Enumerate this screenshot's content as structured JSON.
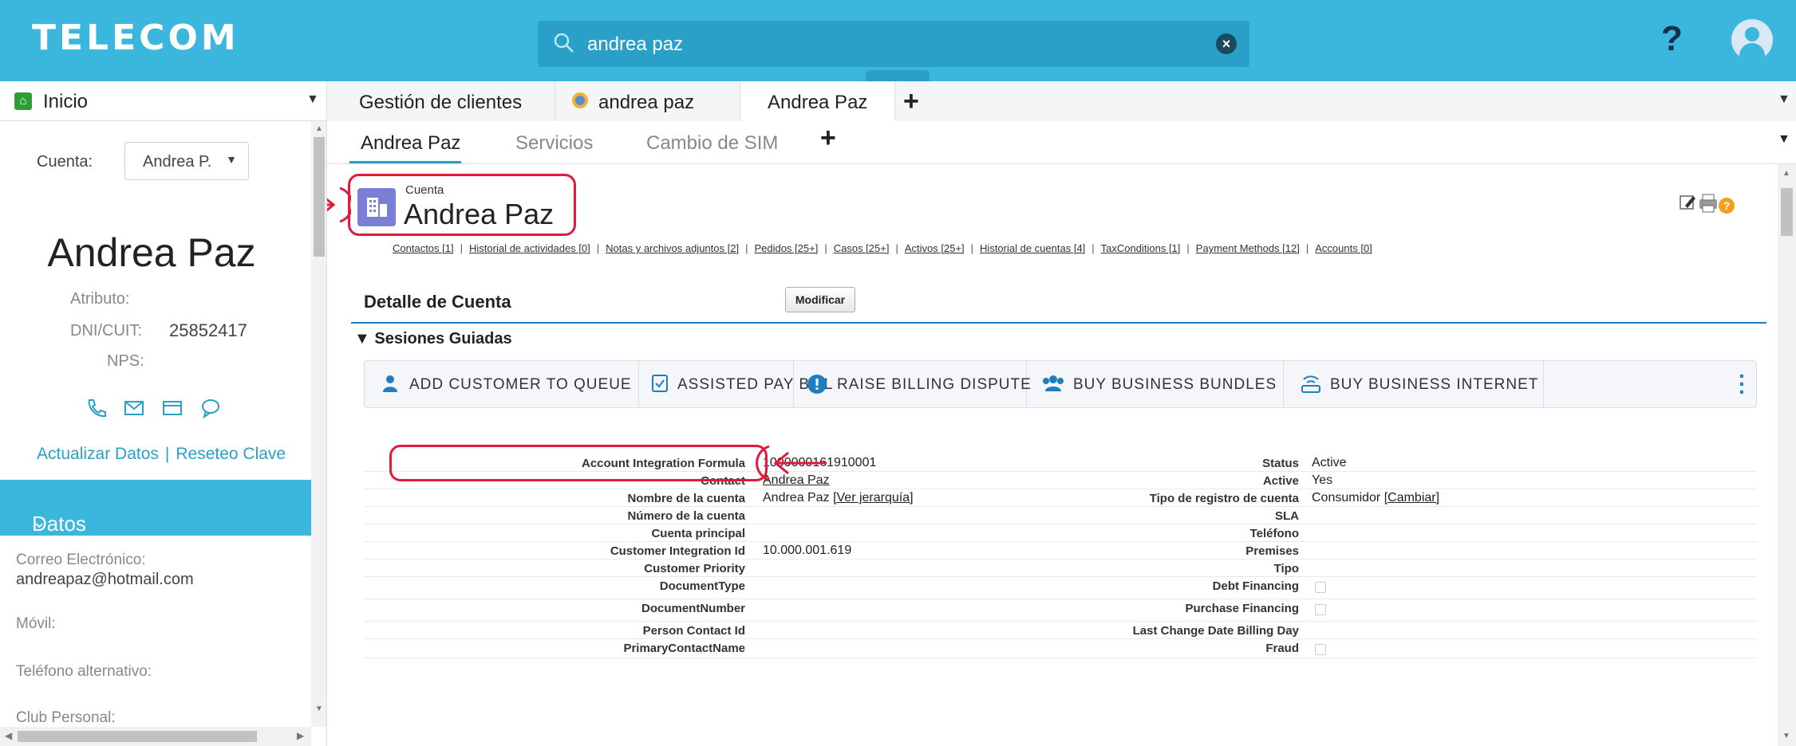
{
  "app": {
    "brand": "TELECOM"
  },
  "search": {
    "value": "andrea paz",
    "clear_label": "×"
  },
  "header": {
    "help_label": "?"
  },
  "workspace_tabs": {
    "home_label": "Inicio",
    "tabs": [
      {
        "label": "Gestión de clientes"
      },
      {
        "label": "andrea paz"
      },
      {
        "label": "Andrea Paz"
      }
    ],
    "add_label": "+"
  },
  "left_panel": {
    "account_label": "Cuenta:",
    "account_select": "Andrea P.",
    "customer_name": "Andrea Paz",
    "atributo_label": "Atributo:",
    "dni_label": "DNI/CUIT:",
    "dni_value": "25852417",
    "nps_label": "NPS:",
    "link_update": "Actualizar Datos",
    "link_sep": "|",
    "link_reset": "Reseteo Clave",
    "section_title": "Datos Personales",
    "email_label": "Correo Electrónico:",
    "email_value": "andreapaz@hotmail.com",
    "mobile_label": "Móvil:",
    "alt_phone_label": "Teléfono alternativo:",
    "club_label": "Club Personal:"
  },
  "subtabs": {
    "items": [
      {
        "label": "Andrea Paz"
      },
      {
        "label": "Servicios"
      },
      {
        "label": "Cambio de SIM"
      }
    ],
    "add_label": "+"
  },
  "record": {
    "type_label": "Cuenta",
    "name": "Andrea Paz"
  },
  "related_links": [
    "Contactos [1]",
    "Historial de actividades [0]",
    "Notas y archivos adjuntos [2]",
    "Pedidos [25+]",
    "Casos [25+]",
    "Activos [25+]",
    "Historial de cuentas [4]",
    "TaxConditions [1]",
    "Payment Methods [12]",
    "Accounts [0]"
  ],
  "detail": {
    "title": "Detalle de Cuenta",
    "edit_button": "Modificar",
    "guided_title": "▼ Sesiones Guiadas"
  },
  "actions": [
    {
      "label": "ADD CUSTOMER TO QUEUE",
      "icon": "person-icon"
    },
    {
      "label": "ASSISTED PAY BILL",
      "icon": "checklist-icon"
    },
    {
      "label": "RAISE BILLING DISPUTE",
      "icon": "alert-icon"
    },
    {
      "label": "BUY BUSINESS BUNDLES",
      "icon": "group-icon"
    },
    {
      "label": "BUY BUSINESS INTERNET",
      "icon": "router-icon"
    }
  ],
  "fields_left": [
    {
      "label": "Account Integration Formula",
      "value": "1000000161910001"
    },
    {
      "label": "Contact",
      "value": "Andrea Paz"
    },
    {
      "label": "Nombre de la cuenta",
      "value": "Andrea Paz ",
      "link": "[Ver jerarquía]"
    },
    {
      "label": "Número de la cuenta",
      "value": ""
    },
    {
      "label": "Cuenta principal",
      "value": ""
    },
    {
      "label": "Customer Integration Id",
      "value": "10.000.001.619"
    },
    {
      "label": "Customer Priority",
      "value": ""
    },
    {
      "label": "DocumentType",
      "value": ""
    },
    {
      "label": "DocumentNumber",
      "value": ""
    },
    {
      "label": "Person Contact Id",
      "value": ""
    },
    {
      "label": "PrimaryContactName",
      "value": ""
    }
  ],
  "fields_right": [
    {
      "label": "Status",
      "value": "Active"
    },
    {
      "label": "Active",
      "value": "Yes"
    },
    {
      "label": "Tipo de registro de cuenta",
      "value": "Consumidor ",
      "link": "[Cambiar]"
    },
    {
      "label": "SLA",
      "value": ""
    },
    {
      "label": "Teléfono",
      "value": ""
    },
    {
      "label": "Premises",
      "value": ""
    },
    {
      "label": "Tipo",
      "value": ""
    },
    {
      "label": "Debt Financing",
      "value": ""
    },
    {
      "label": "Purchase Financing",
      "value": ""
    },
    {
      "label": "Last Change Date Billing Day",
      "value": ""
    },
    {
      "label": "Fraud",
      "value": ""
    }
  ],
  "colors": {
    "brand": "#3bb6dd",
    "highlight": "#e0193d",
    "link": "#2aa0c8",
    "record_icon": "#7a7fd6"
  }
}
